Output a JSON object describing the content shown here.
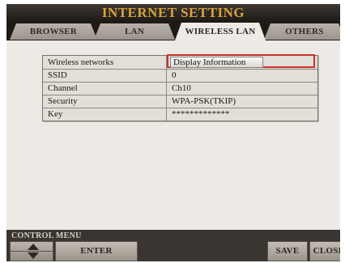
{
  "window": {
    "title": "INTERNET SETTING"
  },
  "tabs": [
    {
      "label": "BROWSER",
      "active": false
    },
    {
      "label": "LAN",
      "active": false
    },
    {
      "label": "WIRELESS LAN",
      "active": true
    },
    {
      "label": "OTHERS",
      "active": false
    }
  ],
  "table": {
    "rows": [
      {
        "label": "Wireless networks",
        "value": "Display Information"
      },
      {
        "label": "SSID",
        "value": "0"
      },
      {
        "label": "Channel",
        "value": "Ch10"
      },
      {
        "label": "Security",
        "value": "WPA-PSK(TKIP)"
      },
      {
        "label": "Key",
        "value": "*************"
      }
    ]
  },
  "control_menu": {
    "label": "CONTROL MENU",
    "up_icon": "arrow-up-icon",
    "down_icon": "arrow-down-icon",
    "enter_label": "ENTER",
    "save_label": "SAVE",
    "close_label": "CLOSE"
  },
  "colors": {
    "title_gold": "#d7a33e",
    "selection_border": "#d03030",
    "panel_background": "#ede9e4",
    "header_dark": "#1e1b17"
  }
}
